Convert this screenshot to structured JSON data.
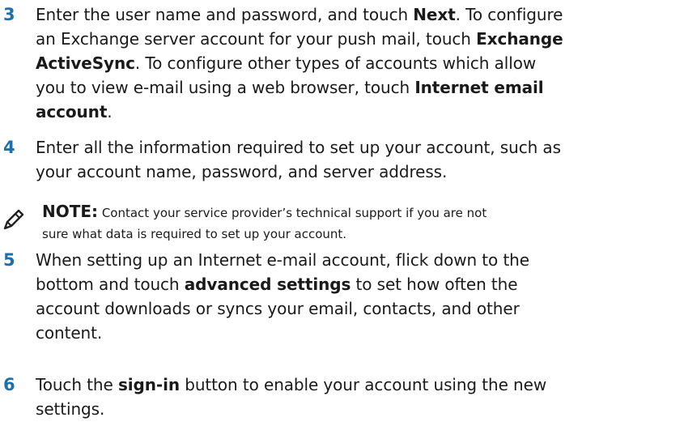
{
  "steps": [
    {
      "number": "3",
      "lines": [
        [
          "Enter the user name and password, and touch ",
          {
            "b": "Next"
          },
          ". To configure"
        ],
        [
          "an Exchange server account for your push mail, touch ",
          {
            "b": "Exchange"
          }
        ],
        [
          {
            "b": "ActiveSync"
          },
          ". To configure other types of accounts which allow"
        ],
        [
          "you to view e-mail using a web browser, touch ",
          {
            "b": "Internet email"
          }
        ],
        [
          {
            "b": "account"
          },
          "."
        ]
      ]
    },
    {
      "number": "4",
      "lines": [
        [
          "Enter all the information required to set up your account, such as"
        ],
        [
          "your account name, password, and server address."
        ]
      ]
    },
    {
      "number": "5",
      "lines": [
        [
          "When setting up an Internet e-mail account, flick down to the"
        ],
        [
          "bottom and touch ",
          {
            "b": "advanced settings"
          },
          " to set how often the"
        ],
        [
          "account downloads or syncs your email, contacts, and other"
        ],
        [
          "content."
        ]
      ]
    },
    {
      "number": "6",
      "lines": [
        [
          "Touch the ",
          {
            "b": "sign-in"
          },
          " button to enable your account using the new"
        ],
        [
          "settings."
        ]
      ]
    }
  ],
  "note": {
    "icon": "pencil-note-icon",
    "label": "NOTE:",
    "lines": [
      "Contact your service provider’s technical support if you are not",
      "sure what data is required to set up your account."
    ]
  }
}
